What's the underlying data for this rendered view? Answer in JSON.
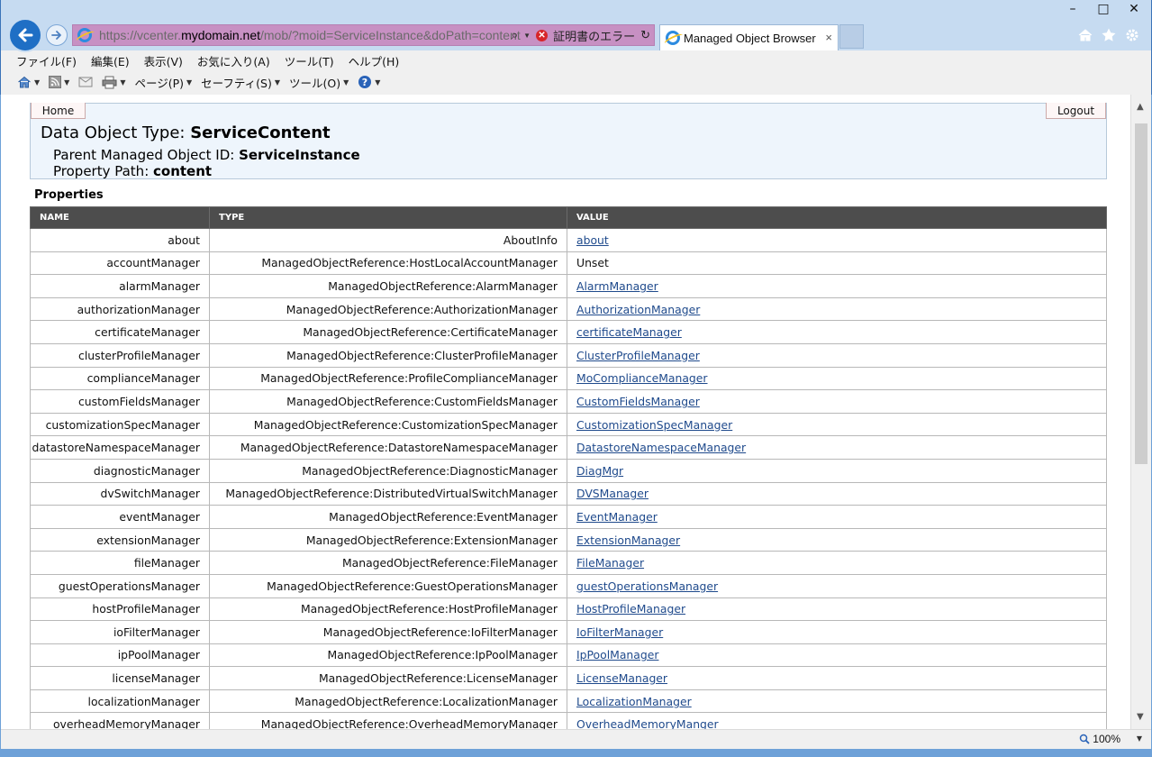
{
  "browser": {
    "address_url_prefix": "https://vcenter.",
    "address_url_domain": "mydomain.net",
    "address_url_suffix": "/mob/?moid=ServiceInstance&doPath=content",
    "cert_error_label": "証明書のエラー",
    "active_tab_title": "Managed Object Browser",
    "tab_close_symbol": "×",
    "window_buttons": [
      "–",
      "□",
      "✕"
    ],
    "toolbar_icons": [
      "home-icon",
      "favorites-star-icon",
      "settings-gear-icon"
    ],
    "menu": [
      "ファイル(F)",
      "編集(E)",
      "表示(V)",
      "お気に入り(A)",
      "ツール(T)",
      "ヘルプ(H)"
    ],
    "command_bar": {
      "page_label": "ページ(P)",
      "safety_label": "セーフティ(S)",
      "tools_label": "ツール(O)"
    },
    "zoom_level": "100%",
    "accent_color": "#1f6fc5",
    "address_bar_error_color": "#c790c3"
  },
  "mob": {
    "home_label": "Home",
    "logout_label": "Logout",
    "type_prefix": "Data Object Type: ",
    "type_value": "ServiceContent",
    "parent_prefix": "Parent Managed Object ID: ",
    "parent_value": "ServiceInstance",
    "path_prefix": "Property Path: ",
    "path_value": "content",
    "properties_heading": "Properties",
    "columns": [
      "NAME",
      "TYPE",
      "VALUE"
    ],
    "rows": [
      {
        "name": "about",
        "type": "AboutInfo",
        "value": "about",
        "link": true
      },
      {
        "name": "accountManager",
        "type": "ManagedObjectReference:HostLocalAccountManager",
        "value": "Unset",
        "link": false
      },
      {
        "name": "alarmManager",
        "type": "ManagedObjectReference:AlarmManager",
        "value": "AlarmManager",
        "link": true
      },
      {
        "name": "authorizationManager",
        "type": "ManagedObjectReference:AuthorizationManager",
        "value": "AuthorizationManager",
        "link": true
      },
      {
        "name": "certificateManager",
        "type": "ManagedObjectReference:CertificateManager",
        "value": "certificateManager",
        "link": true
      },
      {
        "name": "clusterProfileManager",
        "type": "ManagedObjectReference:ClusterProfileManager",
        "value": "ClusterProfileManager",
        "link": true
      },
      {
        "name": "complianceManager",
        "type": "ManagedObjectReference:ProfileComplianceManager",
        "value": "MoComplianceManager",
        "link": true
      },
      {
        "name": "customFieldsManager",
        "type": "ManagedObjectReference:CustomFieldsManager",
        "value": "CustomFieldsManager",
        "link": true
      },
      {
        "name": "customizationSpecManager",
        "type": "ManagedObjectReference:CustomizationSpecManager",
        "value": "CustomizationSpecManager",
        "link": true
      },
      {
        "name": "datastoreNamespaceManager",
        "type": "ManagedObjectReference:DatastoreNamespaceManager",
        "value": "DatastoreNamespaceManager",
        "link": true
      },
      {
        "name": "diagnosticManager",
        "type": "ManagedObjectReference:DiagnosticManager",
        "value": "DiagMgr",
        "link": true
      },
      {
        "name": "dvSwitchManager",
        "type": "ManagedObjectReference:DistributedVirtualSwitchManager",
        "value": "DVSManager",
        "link": true
      },
      {
        "name": "eventManager",
        "type": "ManagedObjectReference:EventManager",
        "value": "EventManager",
        "link": true
      },
      {
        "name": "extensionManager",
        "type": "ManagedObjectReference:ExtensionManager",
        "value": "ExtensionManager",
        "link": true
      },
      {
        "name": "fileManager",
        "type": "ManagedObjectReference:FileManager",
        "value": "FileManager",
        "link": true
      },
      {
        "name": "guestOperationsManager",
        "type": "ManagedObjectReference:GuestOperationsManager",
        "value": "guestOperationsManager",
        "link": true
      },
      {
        "name": "hostProfileManager",
        "type": "ManagedObjectReference:HostProfileManager",
        "value": "HostProfileManager",
        "link": true
      },
      {
        "name": "ioFilterManager",
        "type": "ManagedObjectReference:IoFilterManager",
        "value": "IoFilterManager",
        "link": true
      },
      {
        "name": "ipPoolManager",
        "type": "ManagedObjectReference:IpPoolManager",
        "value": "IpPoolManager",
        "link": true
      },
      {
        "name": "licenseManager",
        "type": "ManagedObjectReference:LicenseManager",
        "value": "LicenseManager",
        "link": true
      },
      {
        "name": "localizationManager",
        "type": "ManagedObjectReference:LocalizationManager",
        "value": "LocalizationManager",
        "link": true
      },
      {
        "name": "overheadMemoryManager",
        "type": "ManagedObjectReference:OverheadMemoryManager",
        "value": "OverheadMemoryManger",
        "link": true
      }
    ]
  }
}
